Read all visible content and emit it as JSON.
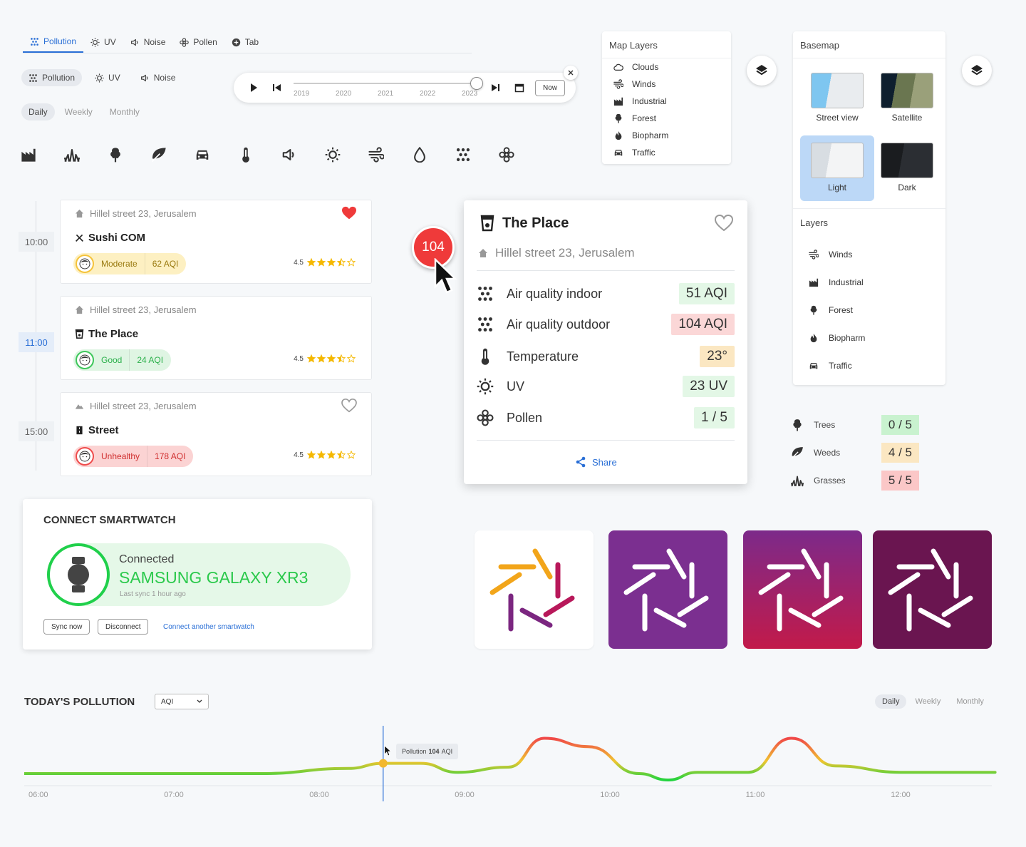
{
  "top_tabs": [
    {
      "label": "Pollution",
      "icon": "particles-icon",
      "active": true
    },
    {
      "label": "UV",
      "icon": "sun-icon"
    },
    {
      "label": "Noise",
      "icon": "speaker-icon"
    },
    {
      "label": "Pollen",
      "icon": "flower-icon"
    },
    {
      "label": "Tab",
      "icon": "plus-circle-icon"
    }
  ],
  "pill_tabs": [
    {
      "label": "Pollution",
      "icon": "particles-icon",
      "active": true
    },
    {
      "label": "UV",
      "icon": "sun-icon"
    },
    {
      "label": "Noise",
      "icon": "speaker-icon"
    }
  ],
  "period_tabs": [
    {
      "label": "Daily",
      "active": true
    },
    {
      "label": "Weekly"
    },
    {
      "label": "Monthly"
    }
  ],
  "icon_row": [
    "factory-icon",
    "grass-icon",
    "tree-icon",
    "leaf-icon",
    "car-icon",
    "thermometer-icon",
    "speaker-icon",
    "sun-icon",
    "wind-icon",
    "drop-icon",
    "particles-icon",
    "flower-icon"
  ],
  "player": {
    "years": [
      "2019",
      "2020",
      "2021",
      "2022",
      "2023"
    ],
    "now_label": "Now",
    "progress": 0.98
  },
  "timeline": {
    "times": [
      "10:00",
      "11:00",
      "15:00"
    ],
    "cards": [
      {
        "address": "Hillel street 23, Jerusalem",
        "name": "Sushi COM",
        "level": "Moderate",
        "aqi": "62 AQI",
        "rating": "4.5",
        "favorite": true,
        "color": "#f5c33b"
      },
      {
        "address": "Hillel street 23, Jerusalem",
        "name": "The Place",
        "level": "Good",
        "aqi": "24 AQI",
        "rating": "4.5",
        "favorite": false,
        "color": "#3ec75b"
      },
      {
        "address": "Hillel street 23, Jerusalem",
        "name": "Street",
        "level": "Unhealthy",
        "aqi": "178 AQI",
        "rating": "4.5",
        "favorite": false,
        "color": "#ef4b4b"
      }
    ]
  },
  "marker": {
    "value": "104"
  },
  "popup": {
    "title": "The Place",
    "address": "Hillel street 23, Jerusalem",
    "share": "Share",
    "metrics": [
      {
        "label": "Air quality indoor",
        "value": "51 AQI",
        "icon": "particles-icon",
        "bg": "#e3f7e6"
      },
      {
        "label": "Air quality outdoor",
        "value": "104 AQI",
        "icon": "particles-icon",
        "bg": "#fbd7d7"
      },
      {
        "label": "Temperature",
        "value": "23°",
        "icon": "thermometer-icon",
        "bg": "#fbe7c2"
      },
      {
        "label": "UV",
        "value": "23 UV",
        "icon": "sun-icon",
        "bg": "#e3f7e6"
      },
      {
        "label": "Pollen",
        "value": "1 / 5",
        "icon": "flower-icon",
        "bg": "#e3f7e6"
      }
    ]
  },
  "map_layers": {
    "title": "Map Layers",
    "items": [
      {
        "label": "Clouds",
        "icon": "cloud-icon"
      },
      {
        "label": "Winds",
        "icon": "wind-icon"
      },
      {
        "label": "Industrial",
        "icon": "factory-icon"
      },
      {
        "label": "Forest",
        "icon": "tree-icon"
      },
      {
        "label": "Biopharm",
        "icon": "flame-icon"
      },
      {
        "label": "Traffic",
        "icon": "car-icon"
      }
    ]
  },
  "basemap": {
    "title": "Basemap",
    "tiles": [
      {
        "label": "Street view"
      },
      {
        "label": "Satellite"
      },
      {
        "label": "Light",
        "active": true
      },
      {
        "label": "Dark"
      }
    ],
    "layers_title": "Layers",
    "layers": [
      {
        "label": "Winds",
        "icon": "wind-icon"
      },
      {
        "label": "Industrial",
        "icon": "factory-icon"
      },
      {
        "label": "Forest",
        "icon": "tree-icon"
      },
      {
        "label": "Biopharm",
        "icon": "flame-icon"
      },
      {
        "label": "Traffic",
        "icon": "car-icon"
      }
    ]
  },
  "pollen": [
    {
      "label": "Trees",
      "value": "0 / 5",
      "icon": "tree-icon",
      "bg": "#c9f2cf"
    },
    {
      "label": "Weeds",
      "value": "4 / 5",
      "icon": "leaf-icon",
      "bg": "#fbe7c2"
    },
    {
      "label": "Grasses",
      "value": "5 / 5",
      "icon": "grass-icon",
      "bg": "#fbc7c7"
    }
  ],
  "smartwatch": {
    "title": "CONNECT SMARTWATCH",
    "status": "Connected",
    "device": "SAMSUNG GALAXY XR3",
    "last_sync": "Last sync 1 hour ago",
    "sync_btn": "Sync now",
    "disconnect_btn": "Disconnect",
    "connect_link": "Connect another smartwatch"
  },
  "chart": {
    "title": "TODAY'S POLLUTION",
    "select_value": "AQI",
    "period_tabs": [
      {
        "label": "Daily",
        "active": true
      },
      {
        "label": "Weekly"
      },
      {
        "label": "Monthly"
      }
    ],
    "tooltip_prefix": "Pollution",
    "tooltip_value": "104",
    "tooltip_unit": "AQI"
  },
  "chart_data": {
    "type": "line",
    "x": [
      "06:00",
      "07:00",
      "08:00",
      "09:00",
      "10:00",
      "11:00",
      "12:00"
    ],
    "series": [
      {
        "values": [
          {
            "t": 6.0,
            "v": 10
          },
          {
            "t": 7.6,
            "v": 10
          },
          {
            "t": 8.2,
            "v": 18
          },
          {
            "t": 8.44,
            "v": 26
          },
          {
            "t": 8.7,
            "v": 26
          },
          {
            "t": 8.95,
            "v": 12
          },
          {
            "t": 9.3,
            "v": 20
          },
          {
            "t": 9.55,
            "v": 65
          },
          {
            "t": 9.85,
            "v": 52
          },
          {
            "t": 10.2,
            "v": 10
          },
          {
            "t": 10.4,
            "v": 0
          },
          {
            "t": 10.6,
            "v": 12
          },
          {
            "t": 10.95,
            "v": 12
          },
          {
            "t": 11.25,
            "v": 65
          },
          {
            "t": 11.55,
            "v": 22
          },
          {
            "t": 12.0,
            "v": 12
          },
          {
            "t": 12.65,
            "v": 12
          }
        ]
      }
    ],
    "highlight_x": 8.44
  }
}
